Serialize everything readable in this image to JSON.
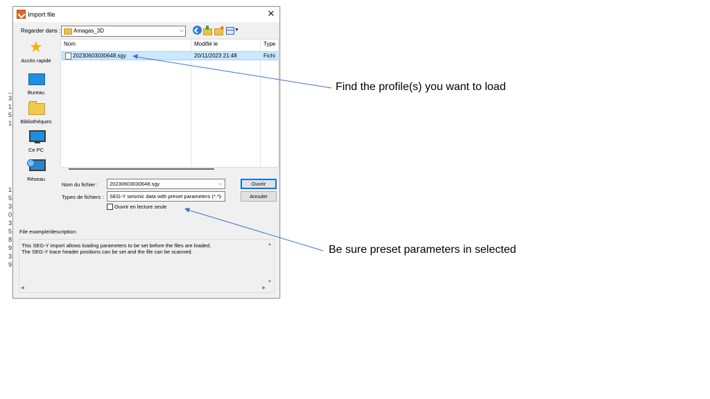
{
  "dialog": {
    "title": "Import file",
    "close_glyph": "✕",
    "look_in_label": "Regarder dans :",
    "look_in_value": "Amagas_3D",
    "toolbar_icons": [
      "back-icon",
      "up-folder-icon",
      "new-folder-icon",
      "view-menu-icon"
    ]
  },
  "places": [
    {
      "label": "Accès rapide",
      "icon": "star-icon"
    },
    {
      "label": "Bureau",
      "icon": "desktop-icon"
    },
    {
      "label": "Bibliothèques",
      "icon": "library-folder-icon"
    },
    {
      "label": "Ce PC",
      "icon": "computer-icon"
    },
    {
      "label": "Réseau",
      "icon": "network-icon"
    }
  ],
  "file_list": {
    "columns": [
      "Nom",
      "Modifié le",
      "Type"
    ],
    "rows": [
      {
        "name": "20230603030648.sgy",
        "modified": "20/11/2023 21:48",
        "type": "Fichi"
      }
    ]
  },
  "form": {
    "filename_label": "Nom du fichier :",
    "filename_value": "20230603030648.sgy",
    "filetype_label": "Types de fichiers :",
    "filetype_value": "SEG-Y seismic data with preset parameters (*.*)",
    "readonly_label": "Ouvrir en lecture seule",
    "open_button": "Ouvrir",
    "cancel_button": "Annuler"
  },
  "description": {
    "label": "File example/description:",
    "lines": [
      "This SEG-Y import allows loading parameters to be set before the files are loaded.",
      "The SEG-Y trace header positions can be set and the file can be scanned."
    ]
  },
  "annotations": {
    "top": "Find the profile(s) you want to load",
    "bottom": "Be sure preset parameters in selected"
  },
  "colors": {
    "selection": "#cce8ff",
    "arrow": "#4472c4",
    "accent": "#0078d7"
  }
}
